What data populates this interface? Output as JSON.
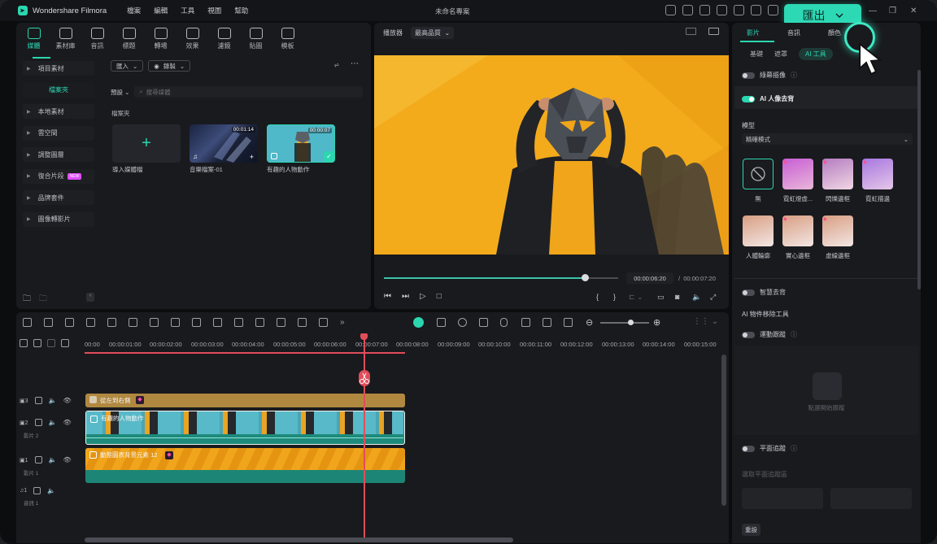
{
  "app": {
    "name": "Wondershare Filmora",
    "doc_title": "未命名專案",
    "menu": [
      "檔案",
      "編輯",
      "工具",
      "視圖",
      "幫助"
    ],
    "export_label": "匯出"
  },
  "media_panel": {
    "tabs": [
      "媒體",
      "素材庫",
      "音訊",
      "標題",
      "轉場",
      "效果",
      "濾鏡",
      "貼圖",
      "模板"
    ],
    "sidebar": {
      "project_media": "項目素材",
      "folder": "檔案夾",
      "items": [
        "本地素材",
        "雲空間",
        "調整圖層",
        "復合片段",
        "品牌套件",
        "圖像轉影片"
      ],
      "new_badge": "NEW"
    },
    "import_label": "匯入",
    "record_label": "錄製",
    "sort_label": "預設",
    "search_placeholder": "搜尋媒體",
    "folder_label": "檔案夾",
    "items": [
      {
        "label": "導入媒體檔",
        "duration": ""
      },
      {
        "label": "音樂檔案-01",
        "duration": "00:01:14"
      },
      {
        "label": "有趣的人物動作",
        "duration": "00:00:07"
      }
    ]
  },
  "player": {
    "label": "播放器",
    "quality": "最高品質",
    "current_time": "00:00:06:20",
    "total_time": "00:00:07:20",
    "progress": 0.87
  },
  "right_panel": {
    "tabs": [
      "影片",
      "音訊",
      "顏色"
    ],
    "subtabs": [
      "基礎",
      "遮罩",
      "AI 工具"
    ],
    "smart_cutout": "綠幕摳像",
    "ai_portrait": "AI 人像去背",
    "model_label": "模型",
    "model_value": "精確模式",
    "effects": [
      "無",
      "霓虹燈虛...",
      "閃爍邊框",
      "霓虹描邊",
      "人體輪廓",
      "實心邊框",
      "虛線邊框"
    ],
    "bg_removal": "智慧去背",
    "ai_object_remover": "AI 物件移除工具",
    "motion_tracking": "運動跟蹤",
    "motion_placeholder": "點選開始跟蹤",
    "planar_tracking": "平面追蹤",
    "planar_hint": "選取平面追蹤區",
    "bottom_label": "重設"
  },
  "timeline": {
    "ruler": [
      "00:00",
      "00:00:01:00",
      "00:00:02:00",
      "00:00:03:00",
      "00:00:04:00",
      "00:00:05:00",
      "00:00:06:00",
      "00:00:07:00",
      "00:00:08:00",
      "00:00:09:00",
      "00:00:10:00",
      "00:00:11:00",
      "00:00:12:00",
      "00:00:13:00",
      "00:00:14:00",
      "00:00:15:00"
    ],
    "tracks": [
      {
        "index": "3",
        "name": ""
      },
      {
        "index": "2",
        "name": "影片 2"
      },
      {
        "index": "1",
        "name": "影片 1"
      },
      {
        "index": "1",
        "name": "音訊 1"
      }
    ],
    "clips": {
      "title": "從左到右側",
      "video": "有趣的人物動作",
      "background": "動態圖表背景元素 12"
    }
  }
}
